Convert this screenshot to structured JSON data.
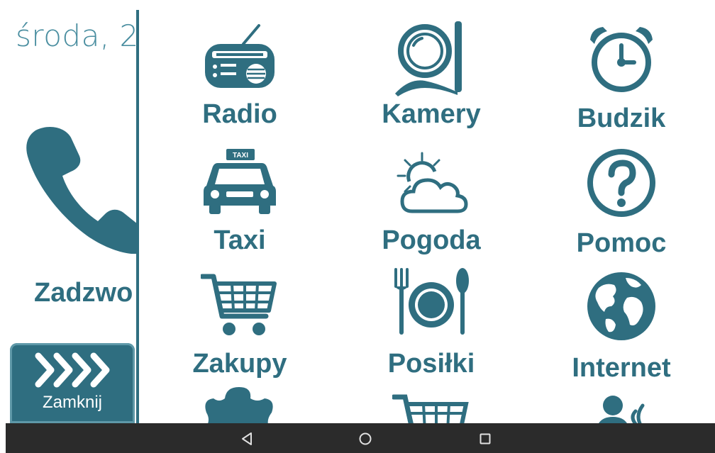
{
  "left_panel": {
    "date": "środa, 2",
    "call_label": "Zadzwo",
    "close_label": "Zamknij"
  },
  "tiles": [
    {
      "label": "Radio",
      "icon": "radio-icon"
    },
    {
      "label": "Kamery",
      "icon": "camera-icon"
    },
    {
      "label": "Budzik",
      "icon": "alarm-clock-icon"
    },
    {
      "label": "Taxi",
      "icon": "taxi-icon"
    },
    {
      "label": "Pogoda",
      "icon": "weather-icon"
    },
    {
      "label": "Pomoc",
      "icon": "help-icon"
    },
    {
      "label": "Zakupy",
      "icon": "shopping-cart-icon"
    },
    {
      "label": "Posiłki",
      "icon": "meal-icon"
    },
    {
      "label": "Internet",
      "icon": "globe-icon"
    }
  ],
  "taxi_sign": "TAXI",
  "colors": {
    "accent": "#2f6e80",
    "nav_bar": "#2b2b2b",
    "background": "#ffffff"
  }
}
